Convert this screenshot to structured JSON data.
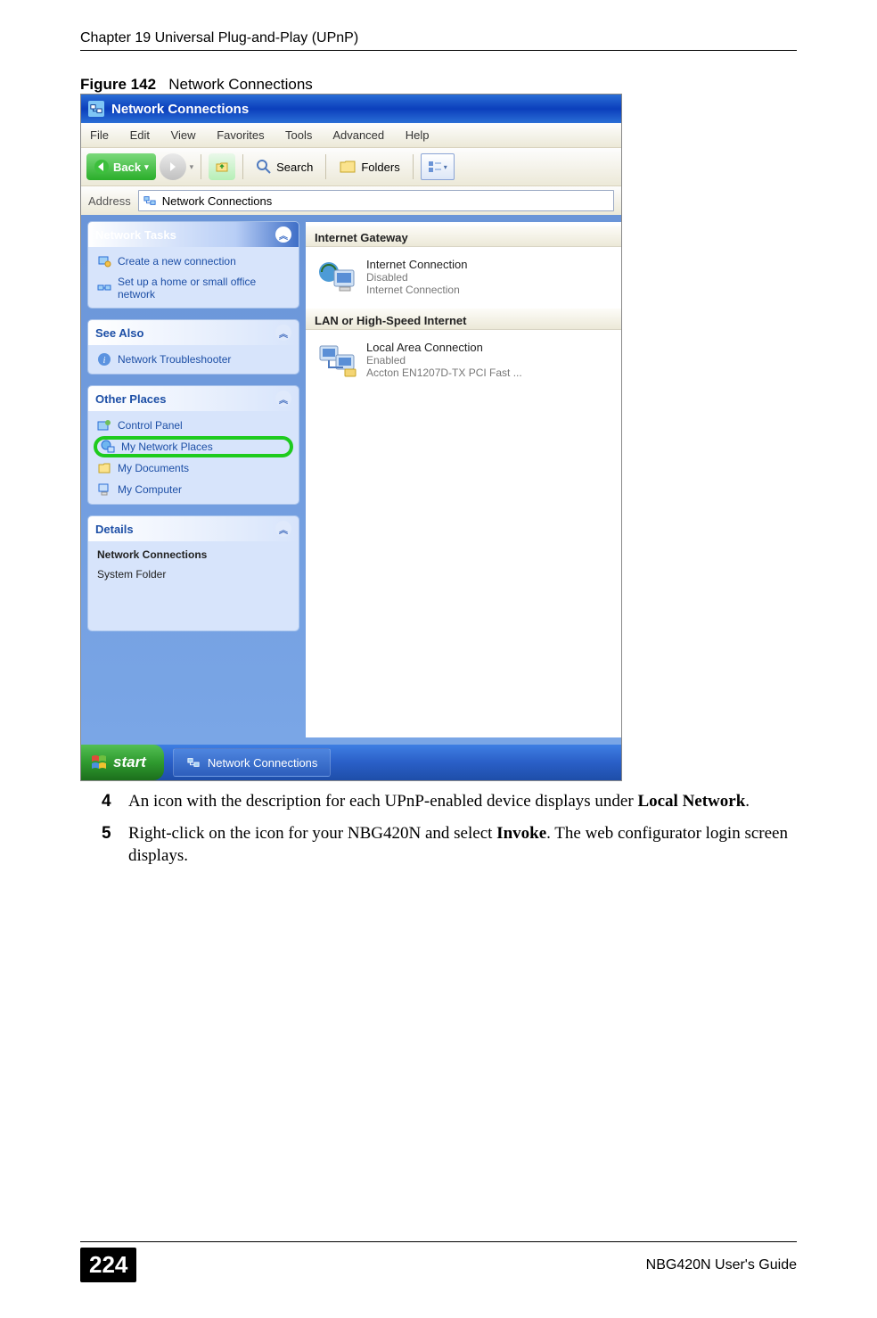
{
  "doc": {
    "chapter_header": "Chapter 19 Universal Plug-and-Play (UPnP)",
    "figure_label": "Figure 142",
    "figure_title": "Network Connections",
    "step4_num": "4",
    "step4_a": "An icon with the description for each UPnP-enabled device displays under ",
    "step4_b": "Local Network",
    "step4_c": ".",
    "step5_num": "5",
    "step5_a": "Right-click on the icon for your NBG420N and select ",
    "step5_b": "Invoke",
    "step5_c": ". The web configurator login screen displays.",
    "page_number": "224",
    "guide": "NBG420N User's Guide"
  },
  "win": {
    "title": "Network Connections",
    "menu": {
      "file": "File",
      "edit": "Edit",
      "view": "View",
      "favorites": "Favorites",
      "tools": "Tools",
      "advanced": "Advanced",
      "help": "Help"
    },
    "toolbar": {
      "back": "Back",
      "search": "Search",
      "folders": "Folders"
    },
    "address_label": "Address",
    "address_value": "Network Connections",
    "panels": {
      "tasks_title": "Network Tasks",
      "task_create": "Create a new connection",
      "task_setup": "Set up a home or small office network",
      "seealso_title": "See Also",
      "seealso_item": "Network Troubleshooter",
      "other_title": "Other Places",
      "other_cp": "Control Panel",
      "other_mnp": "My Network Places",
      "other_md": "My Documents",
      "other_mc": "My Computer",
      "details_title": "Details",
      "details_name": "Network Connections",
      "details_type": "System Folder"
    },
    "groups": {
      "gateway": "Internet Gateway",
      "lan": "LAN or High-Speed Internet"
    },
    "conn1": {
      "name": "Internet Connection",
      "status": "Disabled",
      "device": "Internet Connection"
    },
    "conn2": {
      "name": "Local Area Connection",
      "status": "Enabled",
      "device": "Accton EN1207D-TX PCI Fast ..."
    },
    "taskbar": {
      "start": "start",
      "item": "Network Connections"
    }
  }
}
